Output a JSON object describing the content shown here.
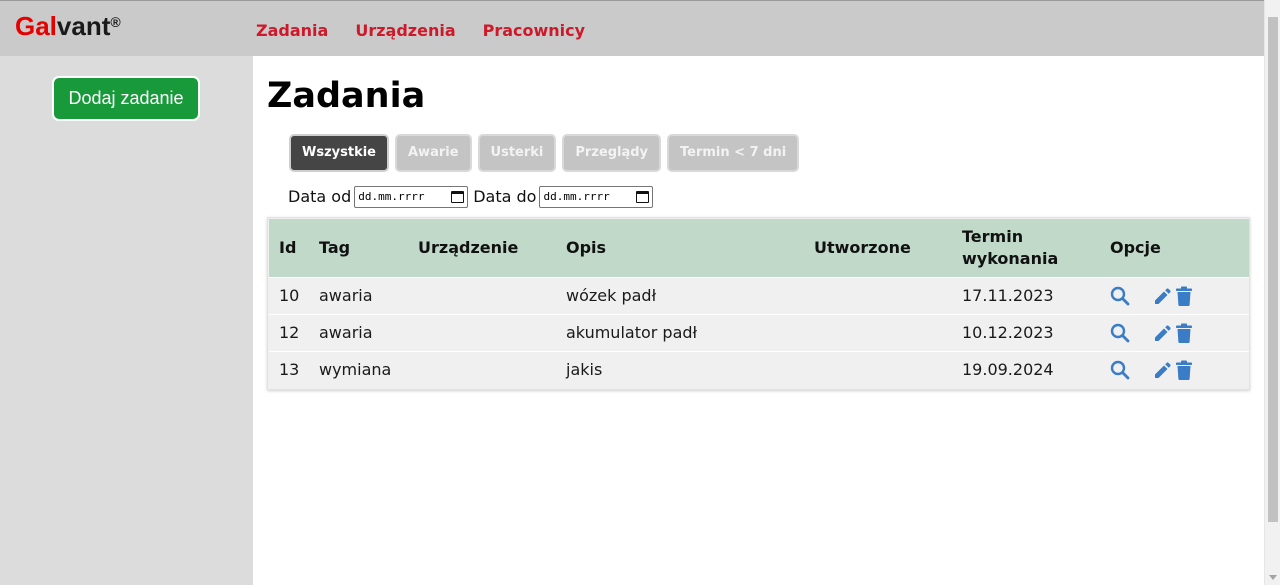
{
  "header": {
    "logo": {
      "red_part": "Gal",
      "dark_part": "vant",
      "mark": "®"
    },
    "nav": [
      "Zadania",
      "Urządzenia",
      "Pracownicy"
    ]
  },
  "sidebar": {
    "add_button_label": "Dodaj zadanie"
  },
  "main": {
    "title": "Zadania",
    "filters": [
      {
        "label": "Wszystkie",
        "active": true
      },
      {
        "label": "Awarie",
        "active": false
      },
      {
        "label": "Usterki",
        "active": false
      },
      {
        "label": "Przeglądy",
        "active": false
      },
      {
        "label": "Termin < 7 dni",
        "active": false
      }
    ],
    "date_from": {
      "label": "Data od",
      "placeholder": "dd.mm.rrrr"
    },
    "date_to": {
      "label": "Data do",
      "placeholder": "dd.mm.rrrr"
    },
    "table": {
      "columns": [
        "Id",
        "Tag",
        "Urządzenie",
        "Opis",
        "Utworzone",
        "Termin wykonania",
        "Opcje"
      ],
      "rows": [
        {
          "id": "10",
          "tag": "awaria",
          "device": "",
          "description": "wózek padł",
          "created": "",
          "deadline": "17.11.2023"
        },
        {
          "id": "12",
          "tag": "awaria",
          "device": "",
          "description": "akumulator padł",
          "created": "",
          "deadline": "10.12.2023"
        },
        {
          "id": "13",
          "tag": "wymiana",
          "device": "",
          "description": "jakis",
          "created": "",
          "deadline": "19.09.2024"
        }
      ],
      "option_icons": [
        "search-icon",
        "edit-icon",
        "trash-icon"
      ]
    }
  },
  "colors": {
    "brand_red": "#e60000",
    "nav_red": "#cc1a2b",
    "add_button_green": "#189a3b",
    "table_header_green": "#c0d9c9",
    "icon_blue": "#3a7cc5",
    "active_filter": "#454545",
    "inactive_filter": "#c4c4c4"
  }
}
